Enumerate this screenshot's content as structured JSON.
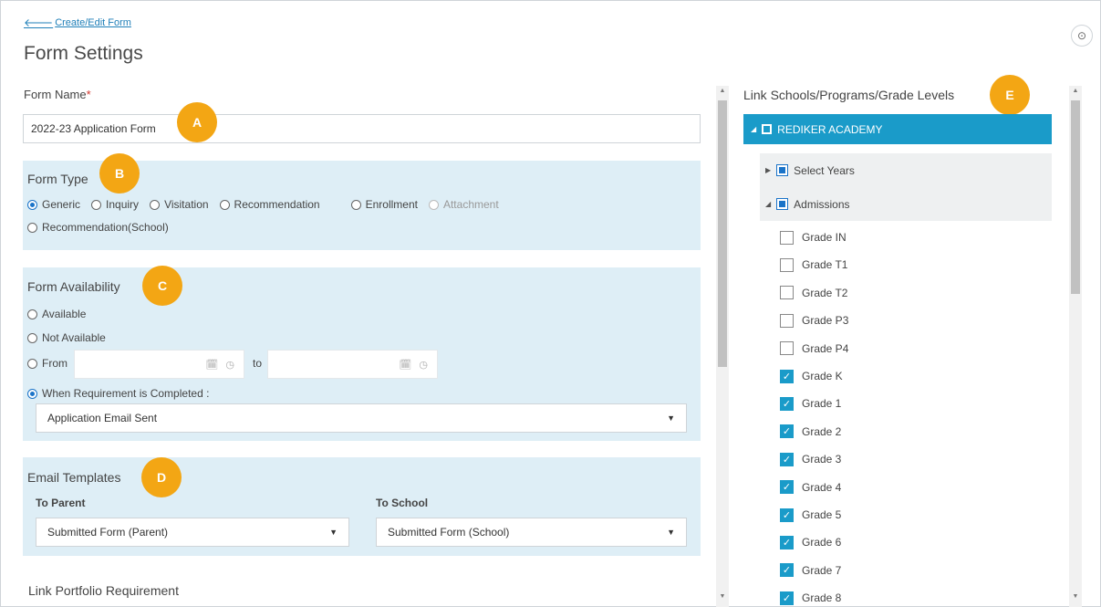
{
  "nav": {
    "back_label": "Create/Edit Form"
  },
  "page": {
    "title": "Form Settings"
  },
  "form_name": {
    "label": "Form Name",
    "required_mark": "*",
    "value": "2022-23 Application Form"
  },
  "badges": {
    "a": "A",
    "b": "B",
    "c": "C",
    "d": "D",
    "e": "E"
  },
  "form_type": {
    "title": "Form Type",
    "options": [
      "Generic",
      "Inquiry",
      "Visitation",
      "Recommendation",
      "Enrollment",
      "Attachment",
      "Recommendation(School)"
    ],
    "selected": "Generic",
    "disabled": "Attachment"
  },
  "form_availability": {
    "title": "Form Availability",
    "options": [
      "Available",
      "Not Available",
      "From",
      "When Requirement is Completed :"
    ],
    "selected": "When Requirement is Completed :",
    "to_label": "to",
    "requirement_value": "Application Email Sent"
  },
  "email_templates": {
    "title": "Email Templates",
    "to_parent_label": "To Parent",
    "to_parent_value": "Submitted Form (Parent)",
    "to_school_label": "To School",
    "to_school_value": "Submitted Form (School)"
  },
  "portfolio": {
    "title": "Link Portfolio Requirement"
  },
  "link_schools": {
    "title": "Link Schools/Programs/Grade Levels",
    "school": "REDIKER ACADEMY",
    "groups": [
      "Select Years",
      "Admissions"
    ],
    "grades": [
      {
        "label": "Grade IN",
        "checked": false
      },
      {
        "label": "Grade T1",
        "checked": false
      },
      {
        "label": "Grade T2",
        "checked": false
      },
      {
        "label": "Grade P3",
        "checked": false
      },
      {
        "label": "Grade P4",
        "checked": false
      },
      {
        "label": "Grade K",
        "checked": true
      },
      {
        "label": "Grade 1",
        "checked": true
      },
      {
        "label": "Grade 2",
        "checked": true
      },
      {
        "label": "Grade 3",
        "checked": true
      },
      {
        "label": "Grade 4",
        "checked": true
      },
      {
        "label": "Grade 5",
        "checked": true
      },
      {
        "label": "Grade 6",
        "checked": true
      },
      {
        "label": "Grade 7",
        "checked": true
      },
      {
        "label": "Grade 8",
        "checked": true
      }
    ]
  },
  "colors": {
    "accent": "#1a9bc9",
    "badge": "#f3a614",
    "section_bg": "#deeef6",
    "link": "#1f7fb8"
  }
}
